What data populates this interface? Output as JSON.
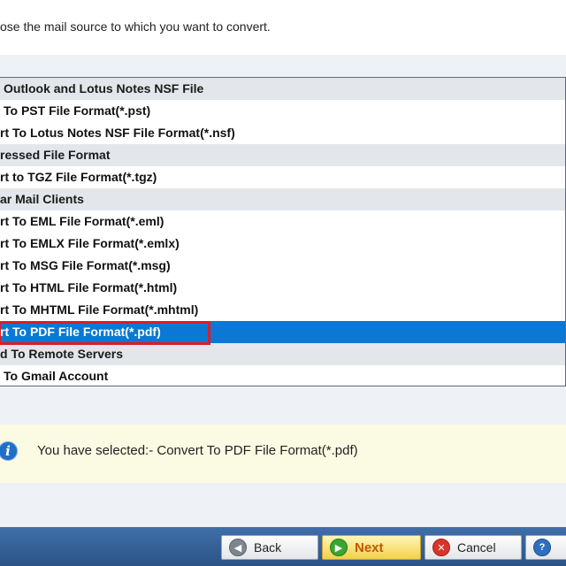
{
  "instruction": "ose the mail source to which you want to convert.",
  "list": [
    {
      "label": "Outlook and Lotus Notes NSF File",
      "kind": "group"
    },
    {
      "label": "To PST File Format(*.pst)",
      "kind": "item"
    },
    {
      "label": "rt To Lotus Notes NSF File Format(*.nsf)",
      "kind": "item"
    },
    {
      "label": "ressed File Format",
      "kind": "group"
    },
    {
      "label": "rt to TGZ File Format(*.tgz)",
      "kind": "item"
    },
    {
      "label": "ar Mail Clients",
      "kind": "group"
    },
    {
      "label": "rt To EML File Format(*.eml)",
      "kind": "item"
    },
    {
      "label": "rt To EMLX File Format(*.emlx)",
      "kind": "item"
    },
    {
      "label": "rt To MSG File Format(*.msg)",
      "kind": "item"
    },
    {
      "label": "rt To HTML File Format(*.html)",
      "kind": "item"
    },
    {
      "label": "rt To MHTML File Format(*.mhtml)",
      "kind": "item"
    },
    {
      "label": "rt To PDF File Format(*.pdf)",
      "kind": "item",
      "selected": true
    },
    {
      "label": "d To Remote Servers",
      "kind": "group"
    },
    {
      "label": "To Gmail Account",
      "kind": "item"
    }
  ],
  "info": {
    "icon": "info-icon",
    "text": "You have selected:- Convert To PDF File Format(*.pdf)"
  },
  "buttons": {
    "back": "Back",
    "next": "Next",
    "cancel": "Cancel"
  },
  "colors": {
    "selection": "#0a78d4",
    "highlight_outline": "#e01b24",
    "next_text": "#c25700"
  }
}
